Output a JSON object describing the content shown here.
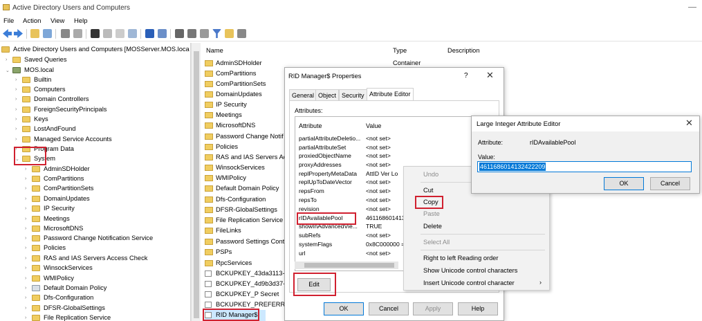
{
  "window": {
    "title": "Active Directory Users and Computers"
  },
  "menu": [
    "File",
    "Action",
    "View",
    "Help"
  ],
  "tree": {
    "root": "Active Directory Users and Computers [MOSServer.MOS.loca",
    "saved_queries": "Saved Queries",
    "domain": "MOS.local",
    "items": [
      "Builtin",
      "Computers",
      "Domain Controllers",
      "ForeignSecurityPrincipals",
      "Keys",
      "LostAndFound",
      "Managed Service Accounts",
      "Program Data",
      "System"
    ],
    "system_children": [
      "AdminSDHolder",
      "ComPartitions",
      "ComPartitionSets",
      "DomainUpdates",
      "IP Security",
      "Meetings",
      "MicrosoftDNS",
      "Password Change Notification Service",
      "Policies",
      "RAS and IAS Servers Access Check",
      "WinsockServices",
      "WMIPolicy",
      "Default Domain Policy",
      "Dfs-Configuration",
      "DFSR-GlobalSettings",
      "File Replication Service"
    ]
  },
  "list": {
    "columns": {
      "name": "Name",
      "type": "Type",
      "description": "Description"
    },
    "rows": [
      {
        "name": "AdminSDHolder",
        "type": "Container"
      },
      {
        "name": "ComPartitions",
        "type": ""
      },
      {
        "name": "ComPartitionSets",
        "type": ""
      },
      {
        "name": "DomainUpdates",
        "type": ""
      },
      {
        "name": "IP Security",
        "type": ""
      },
      {
        "name": "Meetings",
        "type": ""
      },
      {
        "name": "MicrosoftDNS",
        "type": ""
      },
      {
        "name": "Password Change Notif",
        "type": ""
      },
      {
        "name": "Policies",
        "type": ""
      },
      {
        "name": "RAS and IAS Servers Ac",
        "type": ""
      },
      {
        "name": "WinsockServices",
        "type": ""
      },
      {
        "name": "WMIPolicy",
        "type": ""
      },
      {
        "name": "Default Domain Policy",
        "type": ""
      },
      {
        "name": "Dfs-Configuration",
        "type": ""
      },
      {
        "name": "DFSR-GlobalSettings",
        "type": ""
      },
      {
        "name": "File Replication Service",
        "type": ""
      },
      {
        "name": "FileLinks",
        "type": ""
      },
      {
        "name": "Password Settings Cont",
        "type": ""
      },
      {
        "name": "PSPs",
        "type": ""
      },
      {
        "name": "RpcServices",
        "type": ""
      },
      {
        "name": "BCKUPKEY_43da3113-b",
        "type": ""
      },
      {
        "name": "BCKUPKEY_4d9b3d37-9",
        "type": ""
      },
      {
        "name": "BCKUPKEY_P Secret",
        "type": ""
      },
      {
        "name": "BCKUPKEY_PREFERRED",
        "type": ""
      },
      {
        "name": "RID Manager$",
        "type": ""
      }
    ]
  },
  "dialog": {
    "title": "RID Manager$ Properties",
    "help_glyph": "?",
    "tabs": [
      "General",
      "Object",
      "Security",
      "Attribute Editor"
    ],
    "attributes_label": "Attributes:",
    "col_attribute": "Attribute",
    "col_value": "Value",
    "rows": [
      {
        "a": "partialAttributeDeletio...",
        "v": "<not set>"
      },
      {
        "a": "partialAttributeSet",
        "v": "<not set>"
      },
      {
        "a": "proxiedObjectName",
        "v": "<not set>"
      },
      {
        "a": "proxyAddresses",
        "v": "<not set>"
      },
      {
        "a": "replPropertyMetaData",
        "v": "AttID  Ver   Lo"
      },
      {
        "a": "replUpToDateVector",
        "v": "<not set>"
      },
      {
        "a": "repsFrom",
        "v": "<not set>"
      },
      {
        "a": "repsTo",
        "v": "<not set>"
      },
      {
        "a": "revision",
        "v": "<not set>"
      },
      {
        "a": "rIDAvailablePool",
        "v": "461168601413"
      },
      {
        "a": "showInAdvancedVie...",
        "v": "TRUE"
      },
      {
        "a": "subRefs",
        "v": "<not set>"
      },
      {
        "a": "systemFlags",
        "v": "0x8C000000 ="
      },
      {
        "a": "url",
        "v": "<not set>"
      }
    ],
    "edit": "Edit",
    "ok": "OK",
    "cancel": "Cancel",
    "apply": "Apply",
    "help": "Help"
  },
  "context_menu": {
    "items": [
      "Undo",
      "Cut",
      "Copy",
      "Paste",
      "Delete",
      "Select All",
      "Right to left Reading order",
      "Show Unicode control characters",
      "Insert Unicode control character"
    ]
  },
  "editor": {
    "title": "Large Integer Attribute Editor",
    "attribute_label": "Attribute:",
    "attribute_value": "rIDAvailablePool",
    "value_label": "Value:",
    "value": "4611686014132422209",
    "ok": "OK",
    "cancel": "Cancel"
  },
  "colors": {
    "highlight": "#d0202f",
    "selection": "#0078d7",
    "folder": "#f0cd60"
  }
}
